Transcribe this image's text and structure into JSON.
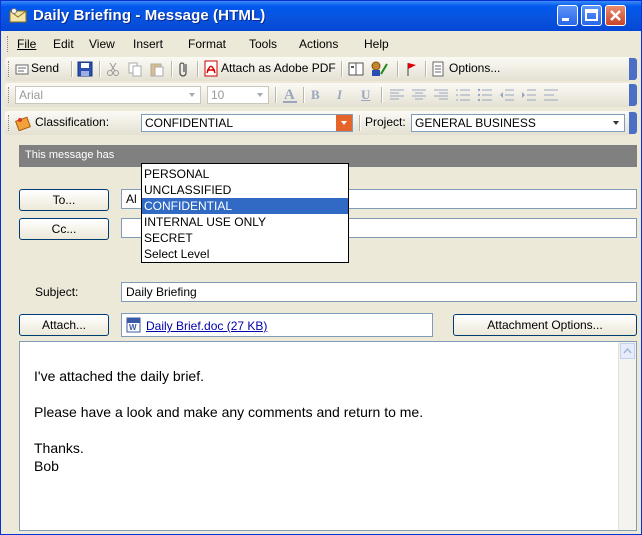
{
  "window": {
    "title": "Daily Briefing - Message (HTML)",
    "colors": {
      "titlebar": "#0058EE",
      "chrome": "#ECE9D8",
      "selection": "#316AC5"
    }
  },
  "menu": [
    "File",
    "Edit",
    "View",
    "Insert",
    "Format",
    "Tools",
    "Actions",
    "Help"
  ],
  "toolbar": {
    "send_label": "Send",
    "attach_pdf_label": "Attach as Adobe PDF",
    "options_label": "Options..."
  },
  "format_bar": {
    "font": "Arial",
    "size": "10",
    "bold": "B",
    "italic": "I",
    "underline": "U"
  },
  "classification_bar": {
    "classification_label": "Classification:",
    "classification_value": "CONFIDENTIAL",
    "project_label": "Project:",
    "project_value": "GENERAL BUSINESS"
  },
  "classification_options": [
    {
      "label": "PERSONAL",
      "selected": false
    },
    {
      "label": "UNCLASSIFIED",
      "selected": false
    },
    {
      "label": "CONFIDENTIAL",
      "selected": true
    },
    {
      "label": "INTERNAL USE ONLY",
      "selected": false
    },
    {
      "label": "SECRET",
      "selected": false
    },
    {
      "label": "Select Level",
      "selected": false
    }
  ],
  "info_bar": {
    "text": "This message has"
  },
  "header": {
    "to_button": "To...",
    "to_value": "Al",
    "cc_button": "Cc...",
    "cc_value": "",
    "subject_label": "Subject:",
    "subject_value": "Daily Briefing",
    "attach_button": "Attach...",
    "attachment": "Daily Brief.doc (27 KB)",
    "attachment_options_button": "Attachment Options..."
  },
  "body": {
    "lines": [
      "I've attached the daily brief.",
      "Please have a look and make any comments and return to me.",
      "Thanks.",
      "Bob"
    ]
  }
}
